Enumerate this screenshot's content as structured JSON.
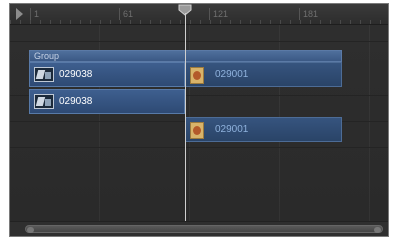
{
  "ruler": {
    "ticks": [
      "1",
      "61",
      "121",
      "181"
    ]
  },
  "tracks": {
    "group_label": "Group",
    "clips": [
      {
        "name": "029038",
        "type": "video",
        "state": "active"
      },
      {
        "name": "029001",
        "type": "image",
        "state": "dimmed"
      },
      {
        "name": "029038",
        "type": "video",
        "state": "active"
      },
      {
        "name": "029001",
        "type": "image",
        "state": "dimmed"
      }
    ]
  },
  "colors": {
    "background": "#2b2b2b",
    "clip": "#3e5f8f",
    "group_bar": "#4f6f9c",
    "playhead": "#cfcfcf"
  }
}
